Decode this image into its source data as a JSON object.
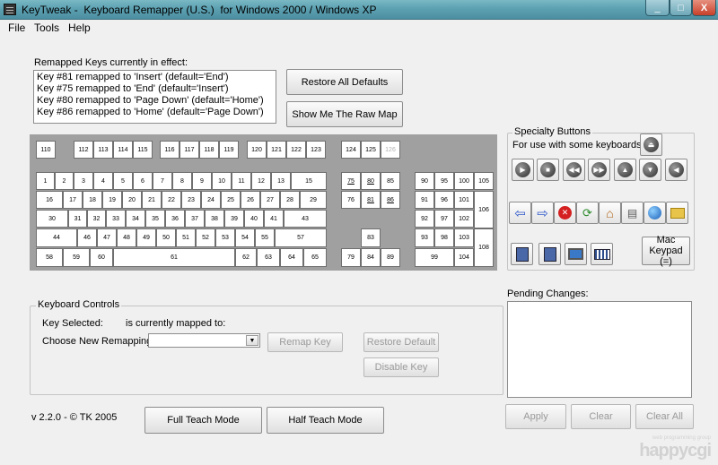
{
  "window": {
    "title": "KeyTweak -  Keyboard Remapper (U.S.)  for Windows 2000 / Windows XP",
    "min_glyph": "_",
    "max_glyph": "□",
    "close_glyph": "X"
  },
  "menu": [
    "File",
    "Tools",
    "Help"
  ],
  "remapped": {
    "label": "Remapped Keys currently in effect:",
    "items": [
      "Key #81 remapped to 'Insert' (default='End')",
      "Key #75 remapped to 'End' (default='Insert')",
      "Key #80 remapped to 'Page Down' (default='Home')",
      "Key #86 remapped to 'Home' (default='Page Down')"
    ]
  },
  "buttons": {
    "restore_all": "Restore All Defaults",
    "raw_map": "Show Me The Raw Map",
    "remap": "Remap Key",
    "restore_default": "Restore Default",
    "disable": "Disable Key",
    "full_teach": "Full Teach Mode",
    "half_teach": "Half Teach Mode",
    "apply": "Apply",
    "clear": "Clear",
    "clear_all": "Clear All",
    "mac_keypad": "Mac Keypad (=)"
  },
  "keyboard": {
    "keys": [
      [
        "110"
      ],
      [
        "112",
        "113",
        "114",
        "115"
      ],
      [
        "116",
        "117",
        "118",
        "119"
      ],
      [
        "120",
        "121",
        "122",
        "123"
      ],
      [
        "124",
        "125",
        "126"
      ],
      [
        "1",
        "2",
        "3",
        "4",
        "5",
        "6",
        "7",
        "8",
        "9",
        "10",
        "11",
        "12",
        "13",
        "15"
      ],
      [
        "16",
        "17",
        "18",
        "19",
        "20",
        "21",
        "22",
        "23",
        "24",
        "25",
        "26",
        "27",
        "28",
        "29"
      ],
      [
        "30",
        "31",
        "32",
        "33",
        "34",
        "35",
        "36",
        "37",
        "38",
        "39",
        "40",
        "41",
        "43"
      ],
      [
        "44",
        "46",
        "47",
        "48",
        "49",
        "50",
        "51",
        "52",
        "53",
        "54",
        "55",
        "57"
      ],
      [
        "58",
        "59",
        "60",
        "61",
        "62",
        "63",
        "64",
        "65"
      ],
      [
        "75",
        "80",
        "85",
        "76",
        "81",
        "86",
        "83",
        "79",
        "84",
        "89"
      ],
      [
        "90",
        "95",
        "100",
        "105",
        "91",
        "96",
        "101",
        "106",
        "92",
        "97",
        "102",
        "93",
        "98",
        "103",
        "108",
        "99",
        "104"
      ]
    ],
    "disabled_keys": [
      "126"
    ],
    "underlined_keys": [
      "75",
      "80",
      "81",
      "86"
    ]
  },
  "specialty": {
    "label": "Specialty Buttons",
    "sublabel": "For use with some keyboards",
    "icons": [
      "eject-icon",
      "play-icon",
      "stop-icon",
      "rewind-icon",
      "fast-forward-icon",
      "volume-up-icon",
      "volume-down-icon",
      "mute-icon",
      "back-arrow-icon",
      "forward-arrow-icon",
      "stop-web-icon",
      "refresh-icon",
      "home-icon",
      "search-doc-icon",
      "favorites-globe-icon",
      "folder-icon",
      "mail-computer-icon",
      "media-computer-icon",
      "my-computer-icon",
      "calculator-icon"
    ]
  },
  "controls": {
    "label": "Keyboard Controls",
    "key_selected": "Key Selected:",
    "mapped_to": "is currently mapped to:",
    "choose": "Choose New Remapping",
    "combo_value": ""
  },
  "pending": {
    "label": "Pending Changes:"
  },
  "version": "v 2.2.0 - © TK 2005",
  "watermark": {
    "small": "web programming group",
    "big": "happycgi"
  }
}
